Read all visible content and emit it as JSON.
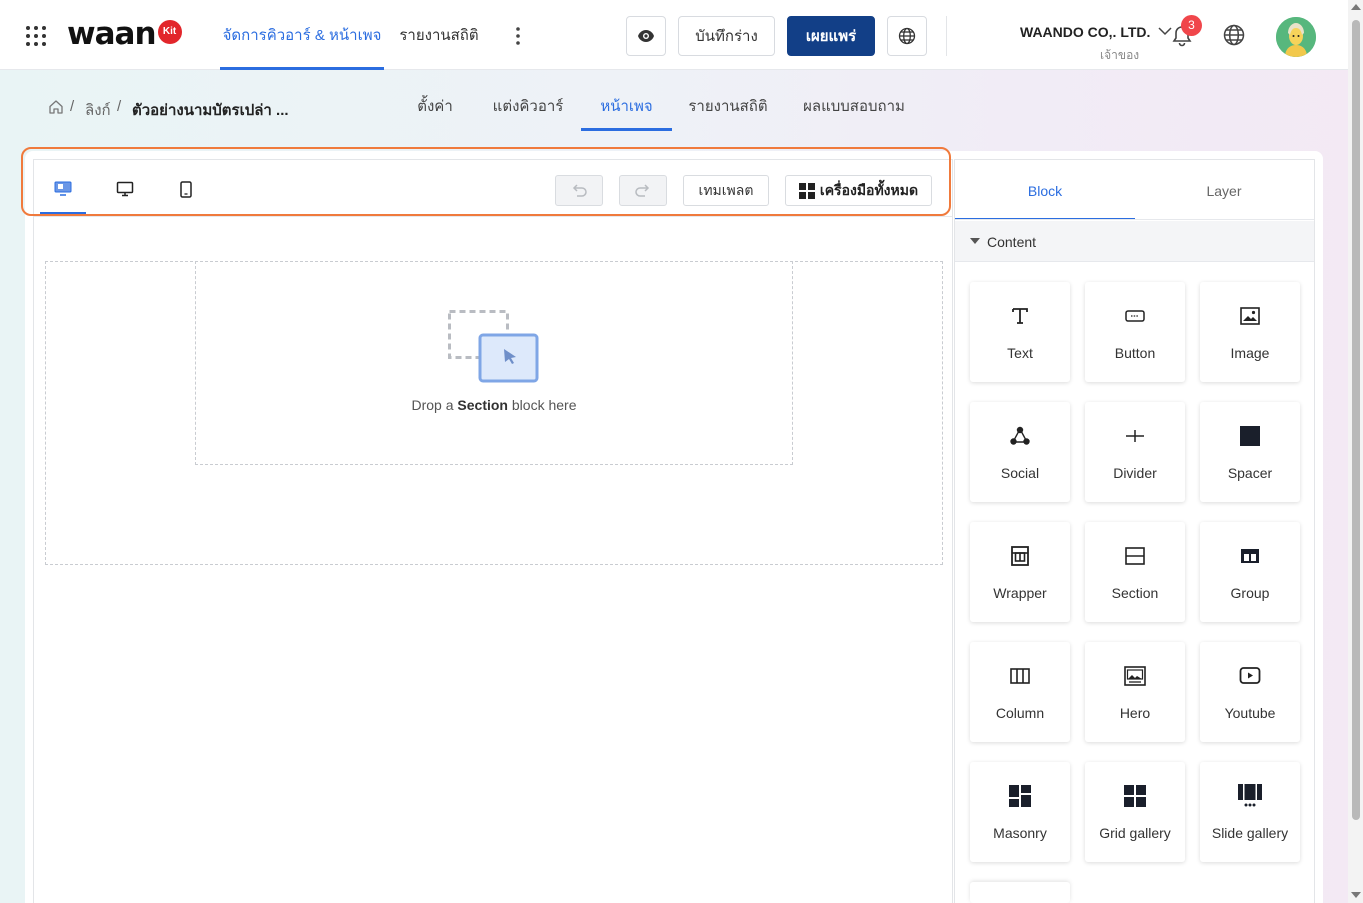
{
  "header": {
    "logo_text": "waan",
    "logo_badge": "Kit",
    "nav": [
      {
        "label": "จัดการคิวอาร์ & หน้าเพจ",
        "active": true
      },
      {
        "label": "รายงานสถิติ",
        "active": false
      }
    ],
    "save_draft_label": "บันทึกร่าง",
    "publish_label": "เผยแพร่",
    "company_name": "WAANDO CO,. LTD.",
    "company_role": "เจ้าของ",
    "notification_count": "3",
    "icons": [
      "apps-grid-icon",
      "more-vertical-icon",
      "eye-icon",
      "globe-icon",
      "chevron-down-icon",
      "bell-icon",
      "language-globe-icon",
      "avatar"
    ]
  },
  "breadcrumb": {
    "items": [
      "ลิงก์"
    ],
    "separator": "/",
    "current": "ตัวอย่างนามบัตรเปล่า ..."
  },
  "subnav": {
    "tabs": [
      {
        "label": "ตั้งค่า",
        "active": false
      },
      {
        "label": "แต่งคิวอาร์",
        "active": false
      },
      {
        "label": "หน้าเพจ",
        "active": true
      },
      {
        "label": "รายงานสถิติ",
        "active": false
      },
      {
        "label": "ผลแบบสอบถาม",
        "active": false
      }
    ]
  },
  "toolbar": {
    "template_label": "เทมเพลต",
    "all_tools_label": "เครื่องมือทั้งหมด",
    "active_device": "responsive",
    "undo_enabled": false,
    "redo_enabled": false
  },
  "canvas": {
    "drop_prefix": "Drop a",
    "drop_emphasis": "Section",
    "drop_suffix": "block here"
  },
  "sidebar": {
    "tabs": [
      {
        "label": "Block",
        "active": true
      },
      {
        "label": "Layer",
        "active": false
      }
    ],
    "section_label": "Content",
    "blocks": [
      {
        "label": "Text",
        "icon": "text-icon"
      },
      {
        "label": "Button",
        "icon": "button-icon"
      },
      {
        "label": "Image",
        "icon": "image-icon"
      },
      {
        "label": "Social",
        "icon": "social-icon"
      },
      {
        "label": "Divider",
        "icon": "divider-icon"
      },
      {
        "label": "Spacer",
        "icon": "spacer-icon"
      },
      {
        "label": "Wrapper",
        "icon": "wrapper-icon"
      },
      {
        "label": "Section",
        "icon": "section-icon"
      },
      {
        "label": "Group",
        "icon": "group-icon"
      },
      {
        "label": "Column",
        "icon": "column-icon"
      },
      {
        "label": "Hero",
        "icon": "hero-icon"
      },
      {
        "label": "Youtube",
        "icon": "youtube-icon"
      },
      {
        "label": "Masonry",
        "icon": "masonry-icon"
      },
      {
        "label": "Grid gallery",
        "icon": "grid-gallery-icon"
      },
      {
        "label": "Slide gallery",
        "icon": "slide-gallery-icon"
      }
    ]
  },
  "colors": {
    "accent": "#2b6de0",
    "primary_button": "#123f87",
    "highlight_border": "#f07a3c",
    "badge_red": "#f0464b",
    "logo_red": "#e2262b"
  }
}
